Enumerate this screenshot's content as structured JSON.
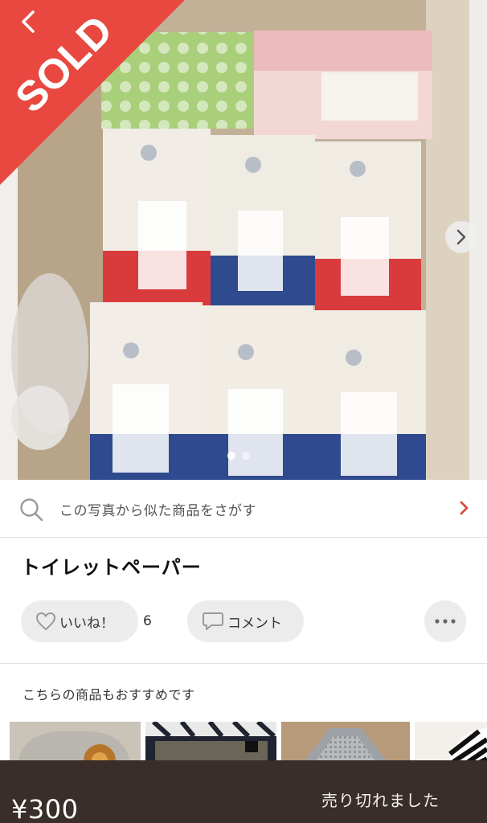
{
  "banner": {
    "label": "SOLD",
    "color": "#e8483f"
  },
  "photo": {
    "pages": 2,
    "active_page": 1
  },
  "similar_search": {
    "label": "この写真から似た商品をさがす",
    "icon": "search-icon"
  },
  "item": {
    "title": "トイレットペーパー"
  },
  "actions": {
    "like_label": "いいね！",
    "like_count": "6",
    "comment_label": "コメント",
    "more_icon": "more-icon"
  },
  "recommend": {
    "heading": "こちらの商品もおすすめです"
  },
  "bottom_bar": {
    "price": "¥300",
    "status": "売り切れました",
    "bg_color": "#3a2e2a"
  },
  "colors": {
    "accent": "#e8483f",
    "chevron": "#d94c44"
  }
}
